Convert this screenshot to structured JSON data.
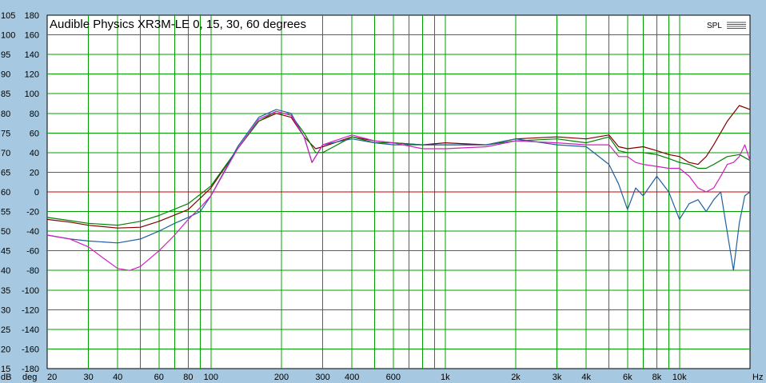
{
  "chart_data": {
    "type": "line",
    "title": "Audible Physics XR3M-LE 0, 15, 30, 60 degrees",
    "xscale": "log",
    "xlim": [
      20,
      20000
    ],
    "xlabel": "Hz",
    "x_ticks": [
      {
        "v": 20,
        "label": "20"
      },
      {
        "v": 30,
        "label": "30"
      },
      {
        "v": 40,
        "label": "40"
      },
      {
        "v": 60,
        "label": "60"
      },
      {
        "v": 80,
        "label": "80"
      },
      {
        "v": 100,
        "label": "100"
      },
      {
        "v": 200,
        "label": "200"
      },
      {
        "v": 300,
        "label": "300"
      },
      {
        "v": 400,
        "label": "400"
      },
      {
        "v": 600,
        "label": "600"
      },
      {
        "v": 1000,
        "label": "1k"
      },
      {
        "v": 2000,
        "label": "2k"
      },
      {
        "v": 3000,
        "label": "3k"
      },
      {
        "v": 4000,
        "label": "4k"
      },
      {
        "v": 6000,
        "label": "6k"
      },
      {
        "v": 8000,
        "label": "8k"
      },
      {
        "v": 10000,
        "label": "10k"
      }
    ],
    "ylim": [
      15,
      105
    ],
    "y_ticks_db": [
      "105",
      "100",
      "95",
      "90",
      "85",
      "80",
      "75",
      "70",
      "65",
      "60",
      "55",
      "50",
      "45",
      "40",
      "35",
      "30",
      "25",
      "20",
      "15"
    ],
    "y_ticks_deg": [
      "180",
      "160",
      "140",
      "120",
      "100",
      "80",
      "60",
      "40",
      "20",
      "0",
      "-20",
      "-40",
      "-60",
      "-80",
      "-100",
      "-120",
      "-140",
      "-160",
      "-180"
    ],
    "y_unit_db": "dB",
    "y_unit_deg": "deg",
    "grid": true,
    "legend": {
      "label": "SPL",
      "placement": "top-right"
    },
    "colors": {
      "plot_bg": "#ffffff",
      "frame_bg": "#a6c8e0",
      "grid": "#00a000",
      "zero_line": "#c00000"
    },
    "reference_line": {
      "y": 60,
      "color": "#c00000"
    },
    "series": [
      {
        "color": "#800000",
        "values": [
          [
            20,
            53
          ],
          [
            25,
            52.3
          ],
          [
            30,
            51.5
          ],
          [
            40,
            50.8
          ],
          [
            50,
            51
          ],
          [
            60,
            52.5
          ],
          [
            80,
            55.5
          ],
          [
            100,
            61
          ],
          [
            130,
            71
          ],
          [
            160,
            78
          ],
          [
            190,
            80
          ],
          [
            220,
            79
          ],
          [
            250,
            74
          ],
          [
            280,
            71
          ],
          [
            300,
            71.5
          ],
          [
            400,
            74
          ],
          [
            500,
            73
          ],
          [
            600,
            72.5
          ],
          [
            800,
            72
          ],
          [
            1000,
            72.5
          ],
          [
            1500,
            72
          ],
          [
            2000,
            73.5
          ],
          [
            3000,
            74
          ],
          [
            4000,
            73.5
          ],
          [
            5000,
            74.5
          ],
          [
            5500,
            71.5
          ],
          [
            6000,
            71
          ],
          [
            7000,
            71.5
          ],
          [
            8000,
            70.5
          ],
          [
            9000,
            69.5
          ],
          [
            10000,
            69
          ],
          [
            11000,
            67.5
          ],
          [
            12000,
            67
          ],
          [
            13000,
            69
          ],
          [
            14000,
            72
          ],
          [
            16000,
            78
          ],
          [
            18000,
            82
          ],
          [
            20000,
            81
          ]
        ]
      },
      {
        "color": "#008000",
        "values": [
          [
            20,
            53.5
          ],
          [
            25,
            52.7
          ],
          [
            30,
            52
          ],
          [
            40,
            51.5
          ],
          [
            50,
            52.5
          ],
          [
            60,
            54
          ],
          [
            80,
            57
          ],
          [
            100,
            61.5
          ],
          [
            130,
            71
          ],
          [
            160,
            78
          ],
          [
            190,
            80.5
          ],
          [
            220,
            79.5
          ],
          [
            250,
            75
          ],
          [
            280,
            70
          ],
          [
            300,
            70
          ],
          [
            400,
            74
          ],
          [
            500,
            72.5
          ],
          [
            600,
            72.5
          ],
          [
            800,
            72
          ],
          [
            1000,
            72
          ],
          [
            1500,
            72
          ],
          [
            2000,
            73
          ],
          [
            3000,
            73.5
          ],
          [
            4000,
            72.5
          ],
          [
            5000,
            74
          ],
          [
            5500,
            70.5
          ],
          [
            6000,
            70
          ],
          [
            7000,
            70
          ],
          [
            8000,
            69.5
          ],
          [
            9000,
            68.5
          ],
          [
            10000,
            67.5
          ],
          [
            11000,
            67
          ],
          [
            12000,
            66
          ],
          [
            13000,
            66
          ],
          [
            14000,
            67
          ],
          [
            16000,
            69
          ],
          [
            18000,
            69.5
          ],
          [
            20000,
            68
          ]
        ]
      },
      {
        "color": "#2060a0",
        "values": [
          [
            20,
            49
          ],
          [
            25,
            48
          ],
          [
            30,
            47.5
          ],
          [
            40,
            47
          ],
          [
            50,
            48
          ],
          [
            60,
            50
          ],
          [
            70,
            52
          ],
          [
            80,
            53.5
          ],
          [
            90,
            55
          ],
          [
            100,
            59
          ],
          [
            130,
            71.5
          ],
          [
            160,
            79
          ],
          [
            190,
            81
          ],
          [
            220,
            80
          ],
          [
            250,
            74
          ],
          [
            270,
            67.5
          ],
          [
            300,
            72
          ],
          [
            400,
            73.5
          ],
          [
            500,
            72.5
          ],
          [
            600,
            72
          ],
          [
            800,
            72
          ],
          [
            1000,
            72
          ],
          [
            1500,
            72
          ],
          [
            2000,
            73.5
          ],
          [
            3000,
            72
          ],
          [
            4000,
            71.5
          ],
          [
            5000,
            67
          ],
          [
            5500,
            62
          ],
          [
            6000,
            55.5
          ],
          [
            6500,
            61
          ],
          [
            7000,
            59
          ],
          [
            8000,
            64
          ],
          [
            9000,
            60
          ],
          [
            10000,
            53
          ],
          [
            11000,
            57
          ],
          [
            12000,
            58
          ],
          [
            13000,
            55
          ],
          [
            14000,
            58
          ],
          [
            15000,
            60
          ],
          [
            17000,
            40
          ],
          [
            18000,
            52
          ],
          [
            19000,
            59
          ],
          [
            20000,
            60
          ]
        ]
      },
      {
        "color": "#d020c0",
        "values": [
          [
            20,
            49
          ],
          [
            25,
            48
          ],
          [
            30,
            46
          ],
          [
            35,
            43
          ],
          [
            40,
            40.5
          ],
          [
            45,
            40
          ],
          [
            50,
            41
          ],
          [
            60,
            45
          ],
          [
            70,
            49
          ],
          [
            80,
            53
          ],
          [
            90,
            56
          ],
          [
            100,
            59
          ],
          [
            130,
            71
          ],
          [
            160,
            78.5
          ],
          [
            190,
            80.5
          ],
          [
            220,
            79.5
          ],
          [
            250,
            74
          ],
          [
            270,
            67.5
          ],
          [
            300,
            72
          ],
          [
            400,
            74.5
          ],
          [
            500,
            73
          ],
          [
            600,
            72.5
          ],
          [
            800,
            71
          ],
          [
            1000,
            71
          ],
          [
            1500,
            71.5
          ],
          [
            2000,
            73
          ],
          [
            3000,
            72.5
          ],
          [
            4000,
            72
          ],
          [
            5000,
            72
          ],
          [
            5500,
            69
          ],
          [
            6000,
            69
          ],
          [
            6500,
            67.5
          ],
          [
            7000,
            67
          ],
          [
            8000,
            66.5
          ],
          [
            9000,
            66
          ],
          [
            10000,
            66
          ],
          [
            11000,
            64
          ],
          [
            12000,
            61
          ],
          [
            13000,
            60
          ],
          [
            14000,
            61
          ],
          [
            15000,
            64
          ],
          [
            16000,
            67
          ],
          [
            17000,
            67.5
          ],
          [
            18000,
            69
          ],
          [
            19000,
            72
          ],
          [
            20000,
            68
          ]
        ]
      }
    ]
  }
}
